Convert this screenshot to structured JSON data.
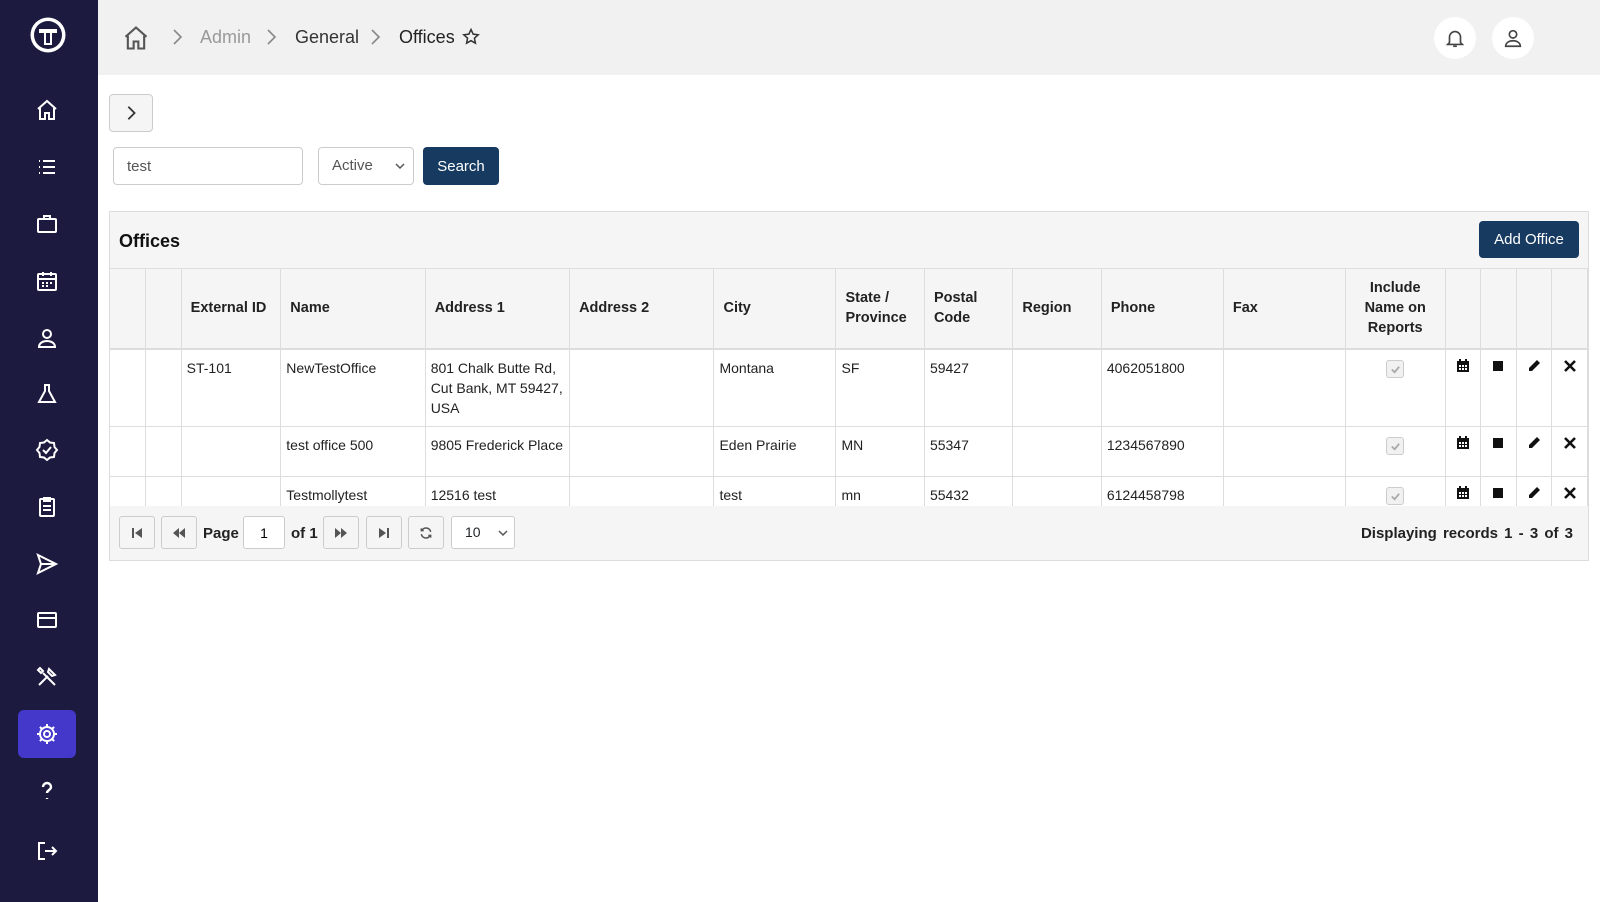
{
  "sidebar": {
    "logo_icon": "company-logo",
    "items": [
      {
        "name": "home",
        "icon": "home-icon",
        "active": false
      },
      {
        "name": "list",
        "icon": "list-icon",
        "active": false
      },
      {
        "name": "briefcase",
        "icon": "briefcase-icon",
        "active": false
      },
      {
        "name": "calendar",
        "icon": "calendar-icon",
        "active": false
      },
      {
        "name": "user",
        "icon": "user-icon",
        "active": false
      },
      {
        "name": "lab",
        "icon": "flask-icon",
        "active": false
      },
      {
        "name": "verified",
        "icon": "badge-check-icon",
        "active": false
      },
      {
        "name": "clipboard",
        "icon": "clipboard-icon",
        "active": false
      },
      {
        "name": "send",
        "icon": "send-icon",
        "active": false
      },
      {
        "name": "billing",
        "icon": "credit-card-icon",
        "active": false
      },
      {
        "name": "tools",
        "icon": "tools-icon",
        "active": false
      },
      {
        "name": "settings",
        "icon": "gear-icon",
        "active": true
      },
      {
        "name": "help",
        "icon": "question-icon",
        "active": false
      },
      {
        "name": "logout",
        "icon": "logout-icon",
        "active": false
      }
    ],
    "accent": "#4338ca",
    "background": "#1c1b3f"
  },
  "breadcrumb": {
    "items": [
      "Admin",
      "General",
      "Offices"
    ]
  },
  "search": {
    "value": "test",
    "status": "Active",
    "button_label": "Search"
  },
  "panel": {
    "title": "Offices",
    "add_label": "Add Office"
  },
  "table": {
    "columns": [
      "External ID",
      "Name",
      "Address 1",
      "Address 2",
      "City",
      "State / Province",
      "Postal Code",
      "Region",
      "Phone",
      "Fax",
      "Include Name on Reports"
    ],
    "rows": [
      {
        "external_id": "ST-101",
        "name": "NewTestOffice",
        "address1": "801 Chalk Butte Rd, Cut Bank, MT 59427, USA",
        "address2": "",
        "city": "Montana",
        "state": "SF",
        "postal": "59427",
        "region": "",
        "phone": "4062051800",
        "fax": "",
        "include": true
      },
      {
        "external_id": "",
        "name": "test office 500",
        "address1": "9805 Frederick Place",
        "address2": "",
        "city": "Eden Prairie",
        "state": "MN",
        "postal": "55347",
        "region": "",
        "phone": "1234567890",
        "fax": "",
        "include": true
      },
      {
        "external_id": "",
        "name": "Testmollytest",
        "address1": "12516 test",
        "address2": "",
        "city": "test",
        "state": "mn",
        "postal": "55432",
        "region": "",
        "phone": "6124458798",
        "fax": "",
        "include": true
      }
    ]
  },
  "pager": {
    "page_label": "Page",
    "page": "1",
    "of_label": "of 1",
    "page_size": "10",
    "records": "Displaying records 1 - 3 of 3"
  }
}
